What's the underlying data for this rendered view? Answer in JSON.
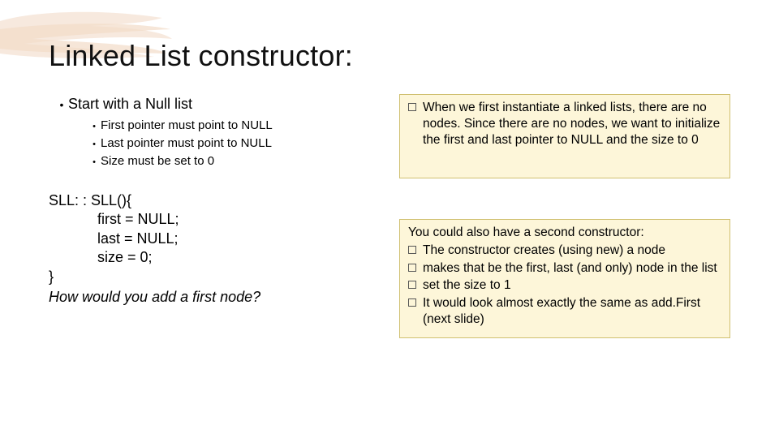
{
  "title": "Linked List constructor:",
  "left": {
    "main": "Start with a Null list",
    "subs": [
      "First pointer must point to NULL",
      "Last pointer must point to NULL",
      "Size must be set to 0"
    ]
  },
  "code": {
    "l1": "SLL: : SLL(){",
    "l2": "first = NULL;",
    "l3": "last = NULL;",
    "l4": "size = 0;",
    "l5": "}",
    "q": "How would you add a first node?"
  },
  "note1": {
    "text": "When we first instantiate a linked lists, there are no nodes.  Since there are no nodes, we want to initialize the first and last pointer to NULL and the size to 0"
  },
  "note2": {
    "intro": "You could also have a second constructor:",
    "items": [
      "The constructor creates (using new) a node",
      "makes that be the first, last (and only) node in the list",
      "set the size to 1",
      "It would look almost exactly the same as add.First (next slide)"
    ]
  }
}
